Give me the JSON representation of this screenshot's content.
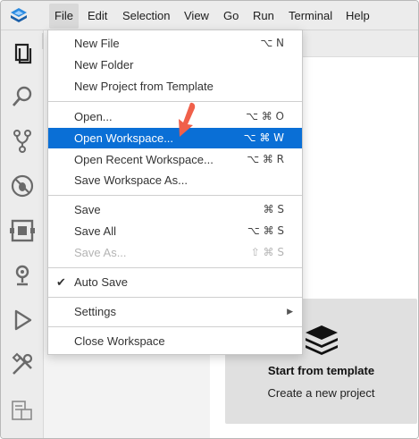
{
  "menubar": {
    "items": [
      "File",
      "Edit",
      "Selection",
      "View",
      "Go",
      "Run",
      "Terminal",
      "Help"
    ]
  },
  "file_menu": {
    "new_file": {
      "label": "New File",
      "shortcut": "⌥ N"
    },
    "new_folder": {
      "label": "New Folder"
    },
    "new_project": {
      "label": "New Project from Template"
    },
    "open": {
      "label": "Open...",
      "shortcut": "⌥ ⌘ O"
    },
    "open_workspace": {
      "label": "Open Workspace...",
      "shortcut": "⌥ ⌘ W"
    },
    "open_recent": {
      "label": "Open Recent Workspace...",
      "shortcut": "⌥ ⌘ R"
    },
    "save_workspace_as": {
      "label": "Save Workspace As..."
    },
    "save": {
      "label": "Save",
      "shortcut": "⌘ S"
    },
    "save_all": {
      "label": "Save All",
      "shortcut": "⌥ ⌘ S"
    },
    "save_as": {
      "label": "Save As...",
      "shortcut": "⇧ ⌘ S"
    },
    "auto_save": {
      "label": "Auto Save",
      "check": "✔"
    },
    "settings": {
      "label": "Settings"
    },
    "close_workspace": {
      "label": "Close Workspace"
    }
  },
  "template_card": {
    "title": "Start from template",
    "subtitle": "Create a new project"
  },
  "activity_icons": [
    "explorer-icon",
    "search-icon",
    "source-control-icon",
    "debug-icon",
    "extensions-icon",
    "remote-icon",
    "run-icon",
    "tools-icon",
    "containers-icon"
  ],
  "colors": {
    "highlight": "#0a6fd6",
    "annotation_arrow": "#f0604a",
    "logo": "#1a73c7"
  }
}
